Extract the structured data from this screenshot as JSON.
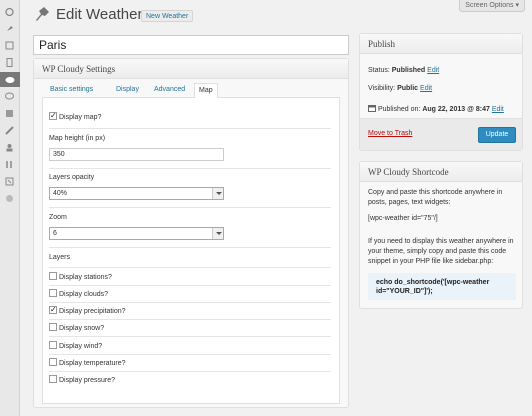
{
  "sidebar": {
    "icons": [
      "dashboard-icon",
      "pin-icon",
      "media-icon",
      "pages-icon",
      "weather-icon",
      "comments-icon",
      "appearance-icon",
      "plugins-icon",
      "users-icon",
      "tools-icon",
      "settings-icon",
      "collapse-icon"
    ]
  },
  "header": {
    "title": "Edit Weather",
    "add_new": "New Weather",
    "screen_options": "Screen Options"
  },
  "post": {
    "title": "Paris"
  },
  "settings_box": {
    "title": "WP Cloudy Settings",
    "tabs": [
      "Basic settings",
      "Display",
      "Advanced",
      "Map"
    ],
    "active_tab": "Map",
    "display_map": {
      "label": "Display map?",
      "checked": true
    },
    "map_height": {
      "label": "Map height (in px)",
      "value": "350"
    },
    "layers_opacity": {
      "label": "Layers opacity",
      "value": "40%"
    },
    "zoom": {
      "label": "Zoom",
      "value": "6"
    },
    "layers_heading": "Layers",
    "layers": [
      {
        "label": "Display stations?",
        "checked": false
      },
      {
        "label": "Display clouds?",
        "checked": false
      },
      {
        "label": "Display precipitation?",
        "checked": true
      },
      {
        "label": "Display snow?",
        "checked": false
      },
      {
        "label": "Display wind?",
        "checked": false
      },
      {
        "label": "Display temperature?",
        "checked": false
      },
      {
        "label": "Display pressure?",
        "checked": false
      }
    ]
  },
  "publish_box": {
    "title": "Publish",
    "status_label": "Status:",
    "status_value": "Published",
    "visibility_label": "Visibility:",
    "visibility_value": "Public",
    "published_label": "Published on:",
    "published_value": "Aug 22, 2013 @ 8:47",
    "edit_label": "Edit",
    "trash": "Move to Trash",
    "update": "Update"
  },
  "shortcode_box": {
    "title": "WP Cloudy Shortcode",
    "intro": "Copy and paste this shortcode anywhere in posts, pages, text widgets:",
    "shortcode": "[wpc-weather id=\"75\"/]",
    "theme_note": "If you need to display this weather anywhere in your theme, simply copy and paste this code snippet in your PHP file like sidebar.php:",
    "php_code": "echo do_shortcode('[wpc-weather id=\"YOUR_ID\"]');"
  }
}
